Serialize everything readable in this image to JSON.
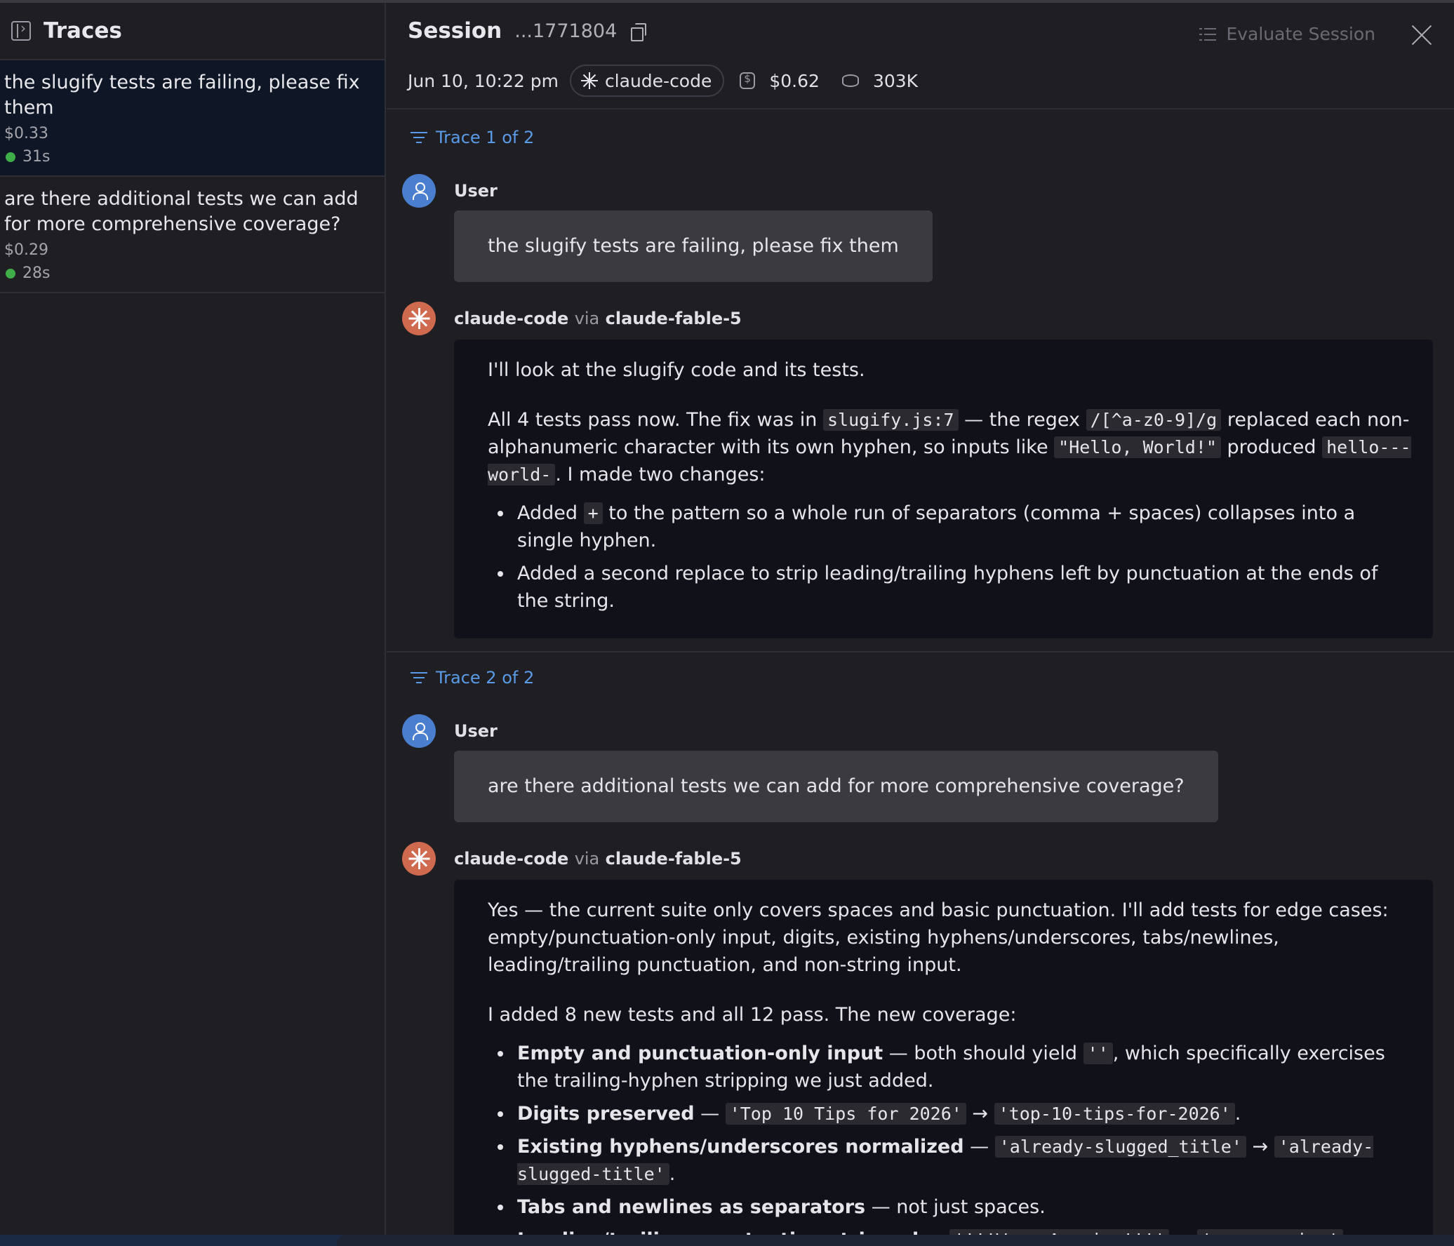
{
  "sidebar": {
    "title": "Traces",
    "items": [
      {
        "question": "the slugify tests are failing, please fix them",
        "cost": "$0.33",
        "duration": "31s",
        "status_color": "#3fae49"
      },
      {
        "question": "are there additional tests we can add for more comprehensive coverage?",
        "cost": "$0.29",
        "duration": "28s",
        "status_color": "#3fae49"
      }
    ]
  },
  "header": {
    "title": "Session",
    "session_id": "...1771804",
    "evaluate_label": "Evaluate Session",
    "date": "Jun 10, 10:22 pm",
    "agent": "claude-code",
    "cost": "$0.62",
    "tokens": "303K"
  },
  "traces": [
    {
      "label": "Trace 1 of 2",
      "user_label": "User",
      "user_message": "the slugify tests are failing, please fix them",
      "agent": "claude-code",
      "via": "via",
      "model": "claude-fable-5",
      "response": {
        "intro": "I'll look at the slugify code and its tests.",
        "p2_a": "All 4 tests pass now. The fix was in ",
        "p2_code1": "slugify.js:7",
        "p2_b": " — the regex ",
        "p2_code2": "/[^a-z0-9]/g",
        "p2_c": " replaced each non-alphanumeric character with its own hyphen, so inputs like ",
        "p2_code3": "\"Hello, World!\"",
        "p2_d": " produced ",
        "p2_code4": "hello---world-",
        "p2_e": ". I made two changes:",
        "b1_a": "Added ",
        "b1_code": "+",
        "b1_b": " to the pattern so a whole run of separators (comma + spaces) collapses into a single hyphen.",
        "b2": "Added a second replace to strip leading/trailing hyphens left by punctuation at the ends of the string."
      }
    },
    {
      "label": "Trace 2 of 2",
      "user_label": "User",
      "user_message": "are there additional tests we can add for more comprehensive coverage?",
      "agent": "claude-code",
      "via": "via",
      "model": "claude-fable-5",
      "response": {
        "intro": "Yes — the current suite only covers spaces and basic punctuation. I'll add tests for edge cases: empty/punctuation-only input, digits, existing hyphens/underscores, tabs/newlines, leading/trailing punctuation, and non-string input.",
        "p2": "I added 8 new tests and all 12 pass. The new coverage:",
        "b1_bold": "Empty and punctuation-only input",
        "b1_a": " — both should yield ",
        "b1_code": "''",
        "b1_b": ", which specifically exercises the trailing-hyphen stripping we just added.",
        "b2_bold": "Digits preserved",
        "b2_a": " — ",
        "b2_code1": "'Top 10 Tips for 2026'",
        "b2_arrow": " → ",
        "b2_code2": "'top-10-tips-for-2026'",
        "b2_end": ".",
        "b3_bold": "Existing hyphens/underscores normalized",
        "b3_a": " — ",
        "b3_code1": "'already-slugged_title'",
        "b3_arrow": " → ",
        "b3_code2": "'already-slugged-title'",
        "b3_end": ".",
        "b4_bold": "Tabs and newlines as separators",
        "b4_a": " — not just spaces.",
        "b5_bold": "Leading/trailing punctuation stripped",
        "b5_a": " — ",
        "b5_code1": "'!!!Wow, Amazing!!!'",
        "b5_arrow": " → ",
        "b5_code2": "'wow-amazing'",
        "b5_end": "."
      }
    }
  ],
  "colors": {
    "accent": "#5a9be8",
    "agent_avatar": "#d06a4f",
    "user_avatar": "#4a7fd0",
    "success": "#3fae49"
  }
}
